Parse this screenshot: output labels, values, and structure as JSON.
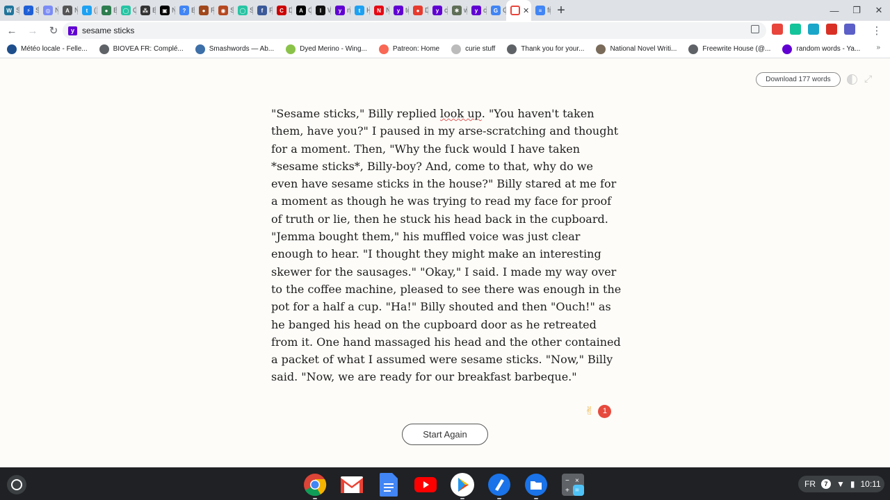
{
  "tabs": [
    {
      "label": "St",
      "color": "#21759b",
      "glyph": "W"
    },
    {
      "label": "S",
      "color": "#1f5fd6",
      "glyph": "⚡"
    },
    {
      "label": "N",
      "color": "#7b8cf5",
      "glyph": "◎"
    },
    {
      "label": "N",
      "color": "#555555",
      "glyph": "A"
    },
    {
      "label": "(1",
      "color": "#1da1f2",
      "glyph": "t"
    },
    {
      "label": "B",
      "color": "#2e7d4f",
      "glyph": "●"
    },
    {
      "label": "O",
      "color": "#27c4a3",
      "glyph": "◯"
    },
    {
      "label": "B",
      "color": "#333333",
      "glyph": "⁂"
    },
    {
      "label": "N",
      "color": "#000000",
      "glyph": "▣"
    },
    {
      "label": "B",
      "color": "#4285f4",
      "glyph": "?"
    },
    {
      "label": "R",
      "color": "#a0481c",
      "glyph": "●"
    },
    {
      "label": "S",
      "color": "#b5471f",
      "glyph": "◉"
    },
    {
      "label": "S",
      "color": "#27c4a3",
      "glyph": "◯"
    },
    {
      "label": "F",
      "color": "#3b5998",
      "glyph": "f"
    },
    {
      "label": "D",
      "color": "#cc0000",
      "glyph": "C"
    },
    {
      "label": "O",
      "color": "#000000",
      "glyph": "A"
    },
    {
      "label": "W",
      "color": "#111111",
      "glyph": "I"
    },
    {
      "label": "n",
      "color": "#6001d2",
      "glyph": "y"
    },
    {
      "label": "H",
      "color": "#1da1f2",
      "glyph": "t"
    },
    {
      "label": "N",
      "color": "#e50914",
      "glyph": "N"
    },
    {
      "label": "tc",
      "color": "#6001d2",
      "glyph": "y"
    },
    {
      "label": "D",
      "color": "#e63b2e",
      "glyph": "●"
    },
    {
      "label": "cı",
      "color": "#6001d2",
      "glyph": "y"
    },
    {
      "label": "w",
      "color": "#5f6e57",
      "glyph": "✱"
    },
    {
      "label": "cı",
      "color": "#6001d2",
      "glyph": "y"
    },
    {
      "label": "G",
      "color": "#4285f4",
      "glyph": "G"
    }
  ],
  "active_tab": {
    "close_label": "✕",
    "color": "#e8453c"
  },
  "last_tab": {
    "label": "fr",
    "color": "#4285f4",
    "glyph": "≡"
  },
  "new_tab_label": "+",
  "window_controls": {
    "minimize": "—",
    "restore": "❐",
    "close": "✕"
  },
  "toolbar": {
    "back": "←",
    "forward": "→",
    "reload": "↻",
    "address_text": "sesame sticks",
    "menu": "⋮"
  },
  "extensions": [
    {
      "name": "puzzle-ext",
      "color": "#e8453c"
    },
    {
      "name": "grammarly-ext",
      "color": "#15c39a"
    },
    {
      "name": "link-ext",
      "color": "#1aa6c9"
    },
    {
      "name": "red-ext",
      "color": "#d93025"
    },
    {
      "name": "shield-ext",
      "color": "#5b5fc7"
    }
  ],
  "bookmarks": [
    {
      "label": "Météo locale - Felle...",
      "color": "#1e4e8c"
    },
    {
      "label": "BIOVEA FR: Complé...",
      "color": "#5f6368"
    },
    {
      "label": "Smashwords — Ab...",
      "color": "#3d6fa8"
    },
    {
      "label": "Dyed Merino - Wing...",
      "color": "#8bc34a"
    },
    {
      "label": "Patreon: Home",
      "color": "#f96854"
    },
    {
      "label": "curie stuff",
      "color": "#bbbbbb"
    },
    {
      "label": "Thank you for your...",
      "color": "#5f6368"
    },
    {
      "label": "National Novel Writi...",
      "color": "#7a6b5a"
    },
    {
      "label": "Freewrite House (@...",
      "color": "#5f6368"
    },
    {
      "label": "random words - Ya...",
      "color": "#6001d2"
    }
  ],
  "bookmarks_more": "»",
  "page": {
    "download_label": "Download 177 words",
    "story_before": "\"Sesame sticks,\" Billy replied ",
    "story_highlight": "look up",
    "story_after": ". \"You haven't taken them, have you?\" I paused in my arse-scratching and thought for a moment. Then, \"Why the fuck would I have taken *sesame sticks*, Billy-boy? And, come to that, why do we even have sesame sticks in the house?\" Billy stared at me for a moment as though he was trying to read my face for proof of truth or lie, then he stuck his head back in the cupboard. \"Jemma bought them,\" his muffled voice was just clear enough to hear. \"I thought they might make an interesting skewer for the sausages.\" \"Okay,\" I said. I made my way over to the coffee machine, pleased to see there was enough in the pot for a half a cup. \"Ha!\" Billy shouted and then \"Ouch!\" as he banged his head on the cupboard door as he retreated from it. One hand massaged his head and the other contained a packet of what I assumed were sesame sticks. \"Now,\" Billy said. \"Now, we are ready for our breakfast barbeque.\"",
    "reaction_emoji": "✌",
    "reaction_count": "1",
    "start_again_label": "Start Again"
  },
  "shelf": {
    "apps": [
      "chrome-app",
      "gmail-app",
      "docs-app",
      "youtube-app",
      "play-store-app",
      "editor-app",
      "files-app",
      "calculator-app"
    ],
    "locale": "FR",
    "notification_count": "7",
    "time": "10:11"
  }
}
